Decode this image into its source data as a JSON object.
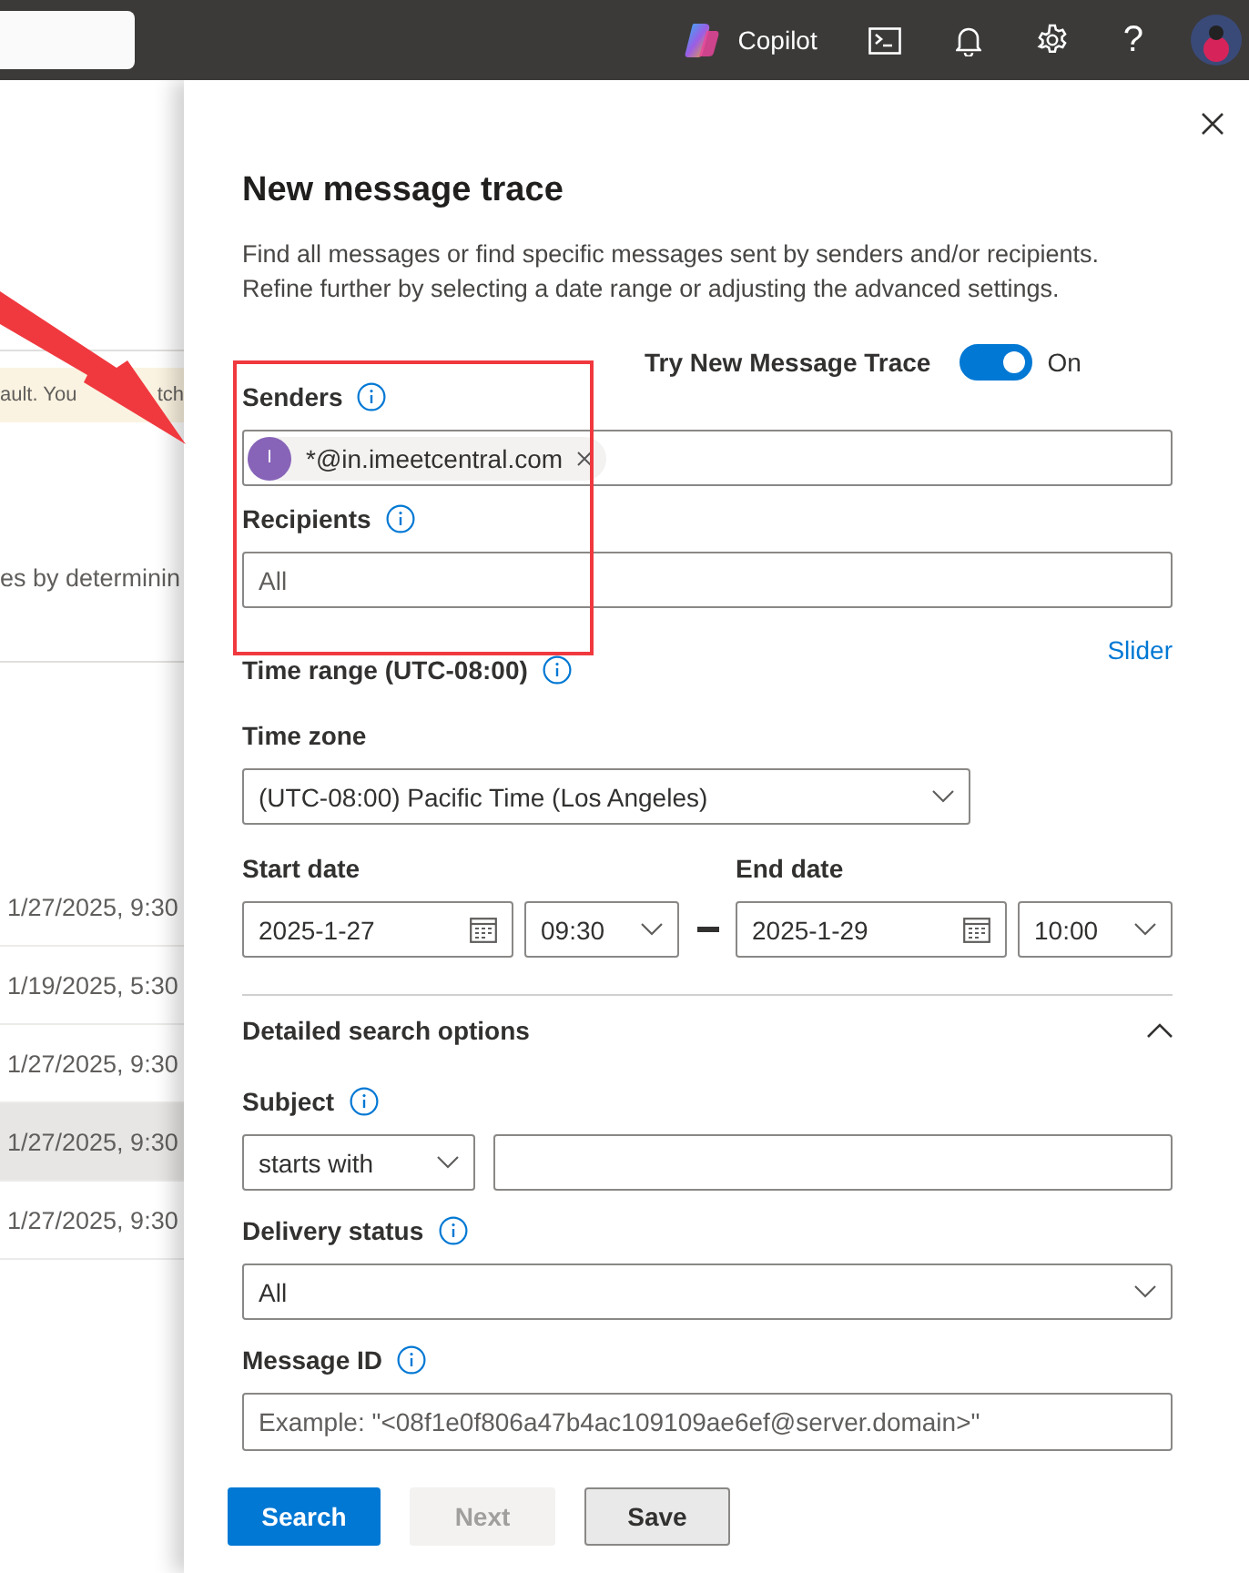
{
  "top_bar": {
    "copilot_label": "Copilot",
    "help_label": "?"
  },
  "background_page": {
    "banner": [
      "ault. You",
      "tch"
    ],
    "description": "es by determinin",
    "rows": [
      {
        "date": "1/27/2025, 9:30",
        "selected": false
      },
      {
        "date": "1/19/2025, 5:30",
        "selected": false
      },
      {
        "date": "1/27/2025, 9:30",
        "selected": false
      },
      {
        "date": "1/27/2025, 9:30",
        "selected": true
      },
      {
        "date": "1/27/2025, 9:30",
        "selected": false
      }
    ]
  },
  "panel": {
    "title": "New message trace",
    "description": "Find all messages or find specific messages sent by senders and/or recipients. Refine further by selecting a date range or adjusting the advanced settings.",
    "toggle": {
      "label": "Try New Message Trace",
      "on": true,
      "state_text": "On"
    },
    "senders": {
      "label": "Senders",
      "chips": [
        {
          "initial": "I",
          "text": "*@in.imeetcentral.com"
        }
      ]
    },
    "recipients": {
      "label": "Recipients",
      "placeholder": "All"
    },
    "slider_link": "Slider",
    "time_range_label": "Time range (UTC-08:00)",
    "time_zone": {
      "label": "Time zone",
      "value": "(UTC-08:00) Pacific Time (Los Angeles)"
    },
    "start_date": {
      "label": "Start date",
      "date": "2025-1-27",
      "time": "09:30"
    },
    "end_date": {
      "label": "End date",
      "date": "2025-1-29",
      "time": "10:00"
    },
    "detailed": {
      "label": "Detailed search options",
      "expanded": true
    },
    "subject": {
      "label": "Subject",
      "operator": "starts with"
    },
    "delivery_status": {
      "label": "Delivery status",
      "value": "All"
    },
    "message_id": {
      "label": "Message ID",
      "placeholder": "Example: \"<08f1e0f806a47b4ac109109ae6ef@server.domain>\""
    }
  },
  "buttons": [
    {
      "label": "Search",
      "kind": "primary",
      "disabled": false
    },
    {
      "label": "Next",
      "kind": "default",
      "disabled": true
    },
    {
      "label": "Save",
      "kind": "default",
      "disabled": false
    }
  ]
}
